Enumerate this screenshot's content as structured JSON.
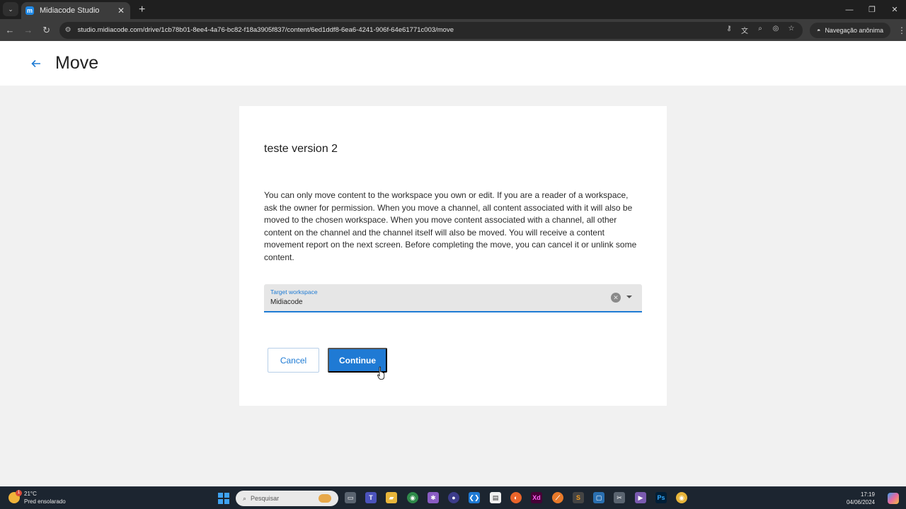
{
  "browser": {
    "tab_title": "Midiacode Studio",
    "tab_favicon_letter": "m",
    "new_tab": "+",
    "url": "studio.midiacode.com/drive/1cb78b01-8ee4-4a76-bc82-f18a3905f837/content/6ed1ddf8-6ea6-4241-906f-64e61771c003/move",
    "incognito_label": "Navegação anônima",
    "accent_color": "#1e7bd4"
  },
  "page": {
    "title": "Move",
    "card": {
      "content_title": "teste version 2",
      "description": "You can only move content to the workspace you own or edit. If you are a reader of a workspace, ask the owner for permission. When you move a channel, all content associated with it will also be moved to the chosen workspace. When you move content associated with a channel, all other content on the channel and the channel itself will also be moved. You will receive a content movement report on the next screen. Before completing the move, you can cancel it or unlink some content.",
      "workspace_field": {
        "label": "Target workspace",
        "value": "Midiacode"
      },
      "cancel_label": "Cancel",
      "continue_label": "Continue"
    }
  },
  "taskbar": {
    "weather_temp": "21°C",
    "weather_desc": "Pred ensolarado",
    "weather_badge": "1",
    "search_placeholder": "Pesquisar",
    "time": "17:19",
    "date": "04/06/2024"
  }
}
